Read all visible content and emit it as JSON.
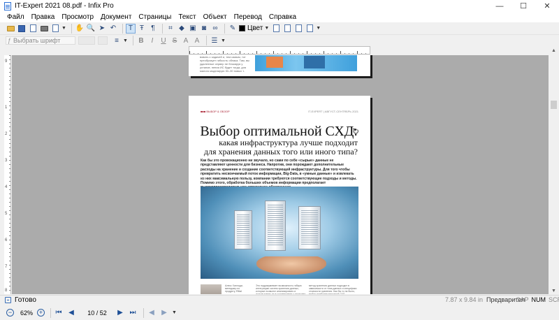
{
  "window": {
    "title": "IT-Expert 2021 08.pdf - Infix Pro",
    "minimize": "—",
    "maximize": "☐",
    "close": "✕"
  },
  "menu": [
    "Файл",
    "Правка",
    "Просмотр",
    "Документ",
    "Страницы",
    "Текст",
    "Объект",
    "Перевод",
    "Справка"
  ],
  "toolbar": {
    "color_label": "Цвет"
  },
  "format_bar": {
    "font_placeholder": "Выбрать шрифт",
    "bold": "B",
    "italic": "I",
    "underline": "U",
    "strike": "S",
    "superscript": "A",
    "subscript": "A"
  },
  "page1": {
    "text": "вовать с задачей и, тем самым, тот преобразует гибкость облака. Там, вы удаленные сервер не блокируя у установ. нения ИС будет тогда, для малого моделирую 30–30 новых т."
  },
  "page2": {
    "header_left": "■■■ ВЫБОР & ОБЗОР",
    "header_right": "IT-EXPERT | АВГУСТ-СЕНТЯБРЬ 2021",
    "title": "Выбор оптимальной СХД:",
    "subtitle_line1": "какая инфраструктура лучше подходит",
    "subtitle_line2": "для хранения данных того или иного типа?",
    "lead": "Как бы это провокационно ни звучало, но сами по себе «сырые» данные не представляют ценности для бизнеса. Напротив, они порождают дополнительные расходы на хранение и создание соответствующей инфраструктуры. Для того чтобы превратить нескончаемый поток информации, Big-Data, в «умные данные» и извлекать из них максимальную пользу, компании требуются соответствующие подходы и методы. Помимо этого, обработка больших объемов информации предполагает высокопроизводительное аппаратное обеспечение.",
    "caption": "Алекс Ханлоди, менеджер по продукту, Rittal",
    "col1": "Это подразумевает возможность гибкую интеграцию систем хранения данных, которые позволят анализировать и использовать их в соответствии с задачами бизнеса.",
    "col2": "метод хранения данных подходит в зависимости от типа данных и специфики стоимости хранения. Как бы то ни было, выбор наиболее выгодной СХД."
  },
  "status": {
    "ready": "Готово",
    "dimensions": "7.87 x 9.84 in",
    "mode": "Предварител",
    "cap": "CAP",
    "num": "NUM",
    "scrl": "SCRL"
  },
  "navigation": {
    "zoom": "62%",
    "page_indicator": "10 / 52"
  },
  "vruler_labels": [
    "9",
    "1",
    "2",
    "3",
    "4",
    "5",
    "6",
    "7",
    "8"
  ]
}
